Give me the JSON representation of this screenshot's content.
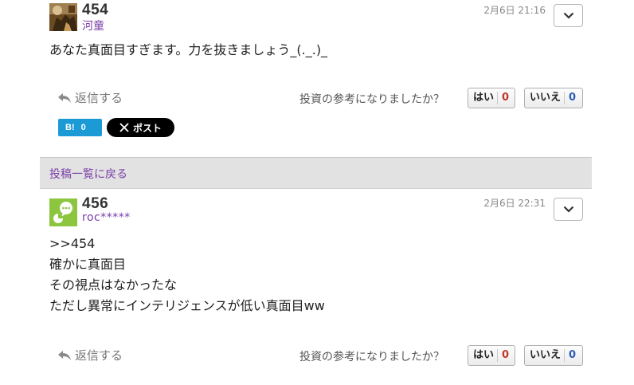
{
  "posts": [
    {
      "number": "454",
      "author": "河童",
      "date": "2月6日 21:16",
      "body": [
        "あなた真面目すぎます。力を抜きましょう_(._.)_"
      ],
      "reply_label": "返信する",
      "helpful_question": "投資の参考になりましたか？",
      "yes_label": "はい",
      "yes_count": "0",
      "no_label": "いいえ",
      "no_count": "0",
      "menu_icon": "chevron-down-icon"
    },
    {
      "number": "456",
      "author": "roc*****",
      "date": "2月6日 22:31",
      "body": [
        ">>454",
        "確かに真面目",
        "その視点はなかったな",
        "ただし異常にインテリジェンスが低い真面目ww"
      ],
      "reply_label": "返信する",
      "helpful_question": "投資の参考になりましたか？",
      "yes_label": "はい",
      "yes_count": "0",
      "no_label": "いいえ",
      "no_count": "0",
      "menu_icon": "chevron-down-icon"
    }
  ],
  "share": {
    "hatena_label": "B!",
    "hatena_count": "0",
    "x_post_label": "ポスト"
  },
  "back_link": "投稿一覧に戻る",
  "colors": {
    "author": "#7a3ea8",
    "yes_count": "#c0392b",
    "no_count": "#2d5db5",
    "hatena": "#1c9ad6",
    "back_bar": "#e2e2e2"
  }
}
